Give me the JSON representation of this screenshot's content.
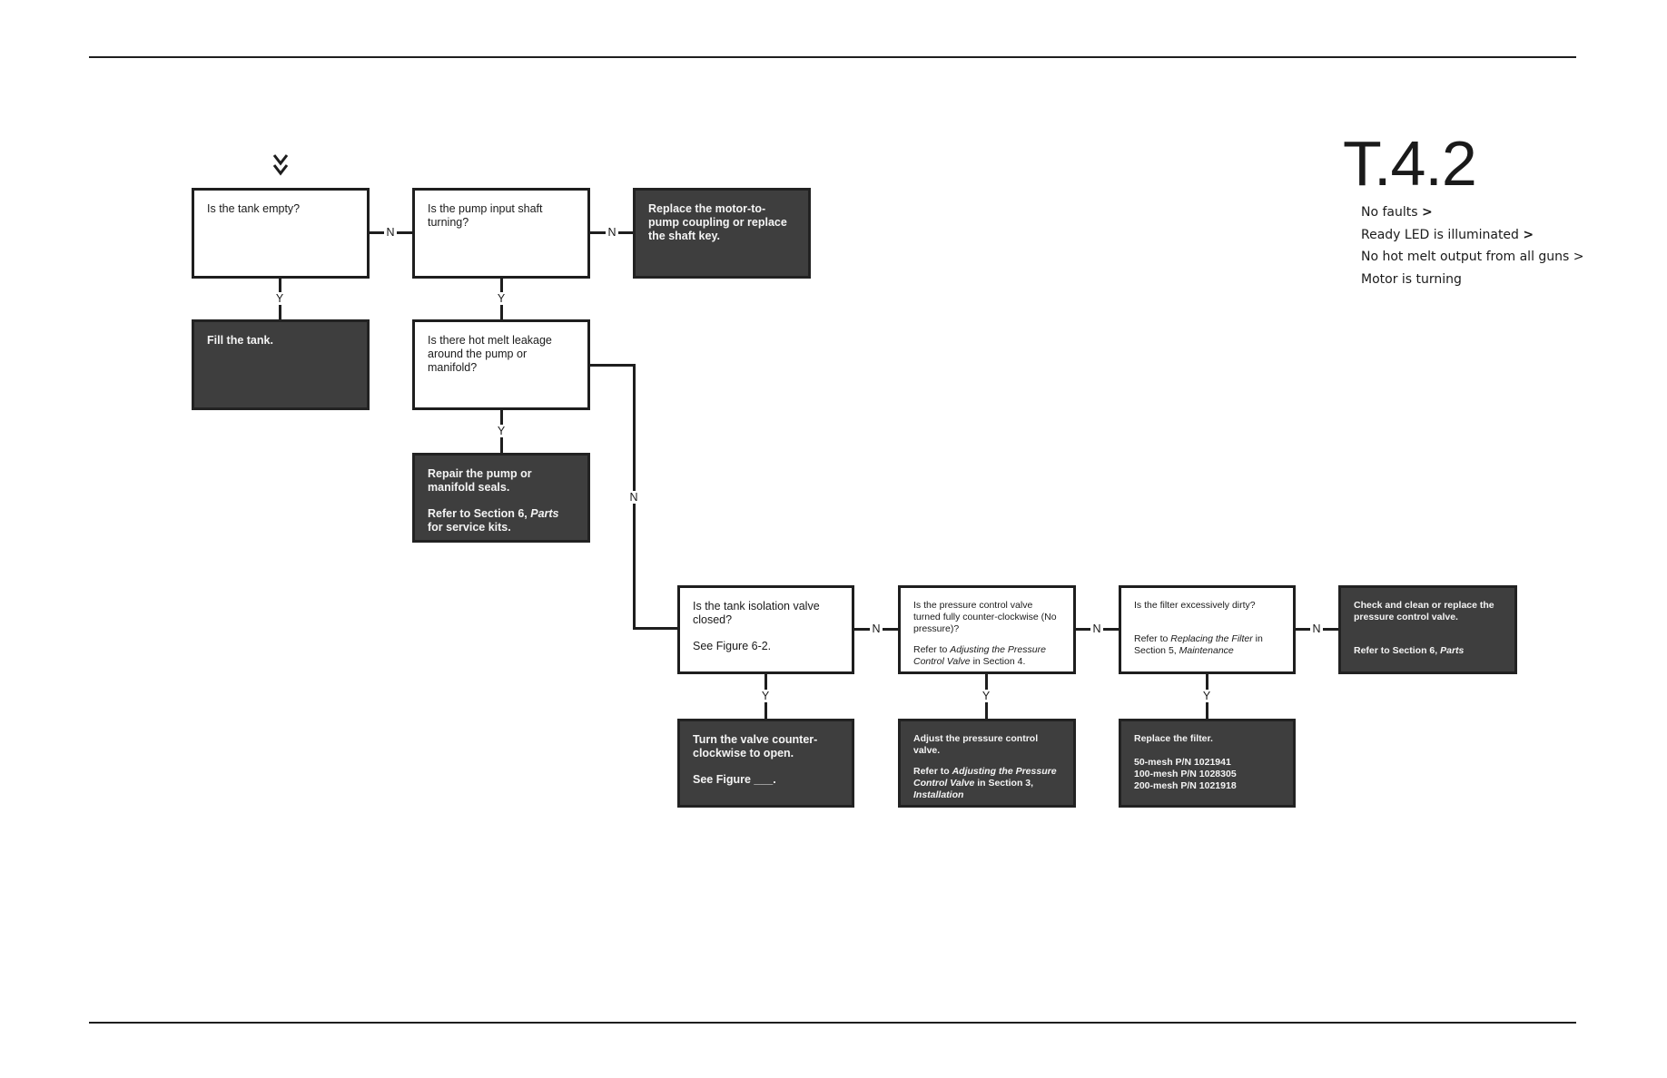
{
  "header": {
    "title": "T.4.2"
  },
  "conditions": [
    {
      "text": "No faults",
      "suffix": ">"
    },
    {
      "text": "Ready LED is illuminated",
      "suffix": ">"
    },
    {
      "text": "No hot melt output from all guns",
      "suffix": ">"
    },
    {
      "text": "Motor is turning",
      "suffix": ""
    }
  ],
  "start_icon": "double-chevron-down-icon",
  "labels": {
    "yes": "Y",
    "no": "N"
  },
  "colors": {
    "action_fill": "#3e3e3e",
    "line": "#1e1e1e",
    "question_fill": "#ffffff"
  },
  "nodes": {
    "tank_empty": {
      "type": "question",
      "lines": [
        "Is the tank empty?"
      ]
    },
    "fill_tank": {
      "type": "action",
      "lines": [
        "Fill the tank."
      ]
    },
    "shaft_turning": {
      "type": "question",
      "lines": [
        "Is the pump input shaft turning?"
      ]
    },
    "replace_coupling": {
      "type": "action",
      "lines": [
        "Replace the motor-to-pump coupling or replace the shaft key."
      ]
    },
    "leakage": {
      "type": "question",
      "lines": [
        "Is there hot melt leakage around the pump or manifold?"
      ]
    },
    "repair_seals": {
      "type": "action",
      "p1": "Repair the pump or manifold seals.",
      "p2a": "Refer to Section 6, ",
      "p2i": "Parts",
      "p2b": "  for service kits."
    },
    "isolation_valve": {
      "type": "question",
      "p1": "Is the tank isolation valve closed?",
      "p2": "See Figure 6-2."
    },
    "turn_valve": {
      "type": "action",
      "p1": "Turn the valve counter-clockwise to open.",
      "p2": "See Figure ___."
    },
    "pressure_valve": {
      "type": "question",
      "p1": "Is the pressure control valve turned fully counter-clockwise  (No pressure)?",
      "p2a": "Refer to ",
      "p2i": "Adjusting the Pressure Control Valve",
      "p2b": " in Section 4."
    },
    "adjust_valve": {
      "type": "action",
      "p1": "Adjust the pressure control valve.",
      "p2a": "Refer to ",
      "p2i": "Adjusting the Pressure Control Valve",
      "p2b": " in Section 3, ",
      "p2i2": "Installation"
    },
    "filter_dirty": {
      "type": "question",
      "p1": "Is the filter excessively dirty?",
      "p2a": "Refer to ",
      "p2i": "Replacing the Filter",
      "p2b": "  in Section 5, ",
      "p2i2": "Maintenance"
    },
    "replace_filter": {
      "type": "action",
      "p1": "Replace  the filter.",
      "parts": [
        "50-mesh P/N 1021941",
        "100-mesh P/N 1028305",
        "200-mesh P/N 1021918"
      ]
    },
    "check_valve": {
      "type": "action",
      "p1": "Check and clean or replace the pressure control valve.",
      "p2a": "Refer to Section 6, ",
      "p2i": "Parts"
    }
  }
}
